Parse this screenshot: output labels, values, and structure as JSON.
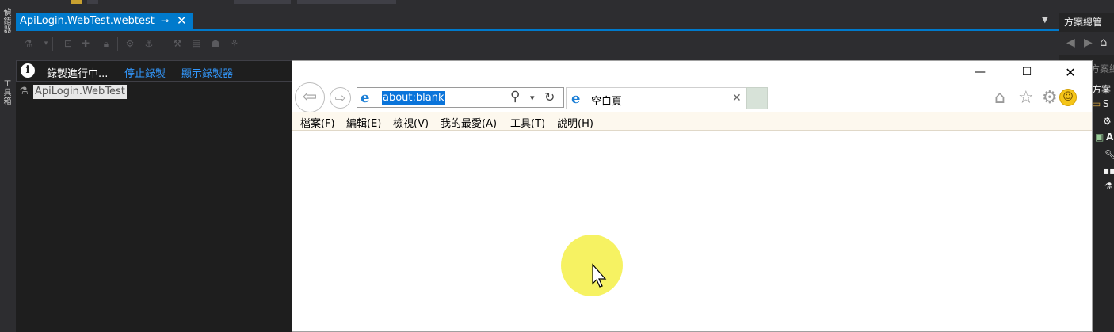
{
  "left_strip": {
    "tab1": "偵錯器",
    "tab2": "工具箱"
  },
  "document_tab": {
    "title": "ApiLogin.WebTest.webtest",
    "pin": "⊸",
    "close": "✕",
    "dropdown": "▼"
  },
  "info_bar": {
    "icon": "i",
    "status": "錄製進行中...",
    "stop_link": "停止錄製",
    "show_link": "顯示錄製器"
  },
  "tree": {
    "root_label": "ApiLogin.WebTest"
  },
  "solution_explorer": {
    "title": "方案總管",
    "partial_title": "方案總",
    "search_partial": "方案",
    "items": [
      "S",
      "A"
    ]
  },
  "ie_window": {
    "minimize": "—",
    "maximize": "☐",
    "close": "✕",
    "back": "⇦",
    "forward": "⇨",
    "address": "about:blank",
    "search_icon": "⚲",
    "dropdown": "▾",
    "refresh": "↻",
    "tab_label": "空白頁",
    "tab_close": "✕",
    "menu": [
      "檔案(F)",
      "編輯(E)",
      "檢視(V)",
      "我的最愛(A)",
      "工具(T)",
      "說明(H)"
    ]
  },
  "colors": {
    "accent": "#007acc",
    "link": "#3399ff",
    "cursor_highlight": "#f5f046"
  }
}
